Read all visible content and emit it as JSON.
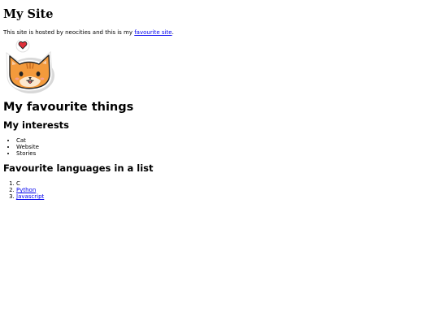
{
  "site": {
    "title": "My Site",
    "intro_text": "This site is hosted by neocities and this is my",
    "intro_link": "favourite site",
    "intro_suffix": "."
  },
  "image": {
    "icon": "cat-sticker-icon"
  },
  "favourites": {
    "heading": "My favourite things",
    "interests_heading": "My interests",
    "interests": [
      "Cat",
      "Website",
      "Stories"
    ],
    "languages_heading": "Favourite languages in a list",
    "languages": [
      {
        "label": "C",
        "link": false
      },
      {
        "label": "Python",
        "link": true
      },
      {
        "label": "Javascript",
        "link": true
      }
    ]
  }
}
